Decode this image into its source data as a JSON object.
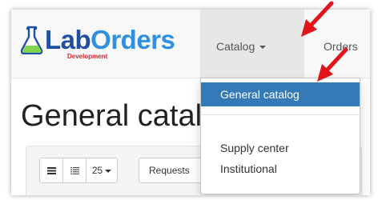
{
  "brand": {
    "lab": "Lab",
    "orders": "Orders",
    "subtitle": "Development"
  },
  "nav": {
    "catalog": "Catalog",
    "orders": "Orders"
  },
  "page": {
    "title": "General catalog"
  },
  "toolbar": {
    "page_size": "25",
    "requests_label": "Requests"
  },
  "dropdown": {
    "items": [
      {
        "label": "General catalog",
        "active": true
      },
      {
        "label": "Supply center",
        "active": false
      },
      {
        "label": "Institutional",
        "active": false
      }
    ]
  },
  "colors": {
    "active_item": "#337ab7",
    "annotation_arrow": "#e2141b",
    "brand_dark": "#1f4fa3",
    "brand_light": "#2f8fe0",
    "brand_sub": "#d9262a"
  }
}
